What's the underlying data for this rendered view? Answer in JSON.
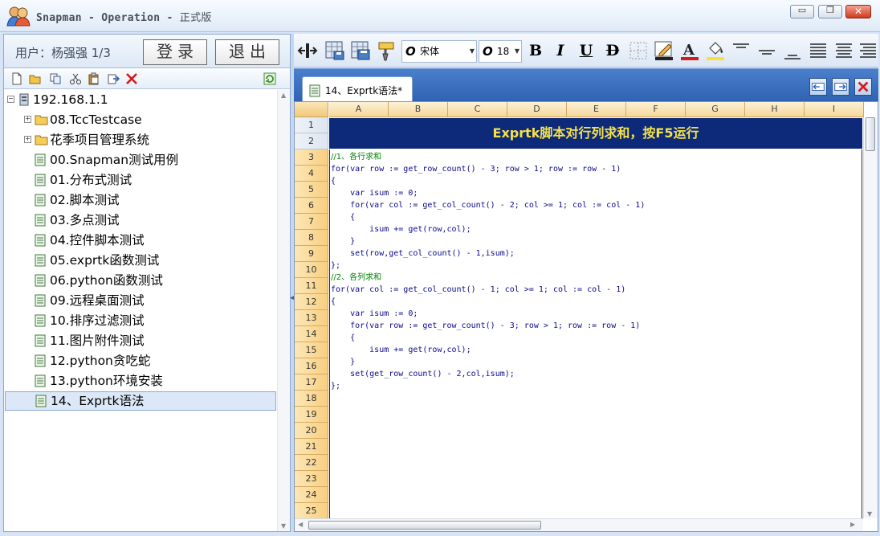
{
  "window": {
    "title": "Snapman - Operation - ",
    "title_edition": "正式版",
    "minimize_glyph": "▭",
    "restore_glyph": "❐",
    "close_glyph": "✕"
  },
  "user_bar": {
    "user_label": "用户：杨强强 1/3",
    "login_label": "登录",
    "logout_label": "退出"
  },
  "tree": {
    "root": "192.168.1.1",
    "folders": [
      "08.TccTestcase",
      "花季项目管理系统"
    ],
    "items": [
      "00.Snapman测试用例",
      "01.分布式测试",
      "02.脚本测试",
      "03.多点测试",
      "04.控件脚本测试",
      "05.exprtk函数测试",
      "06.python函数测试",
      "09.远程桌面测试",
      "10.排序过滤测试",
      "11.图片附件测试",
      "12.python贪吃蛇",
      "13.python环境安装",
      "14、Exprtk语法"
    ],
    "selected_index": 12
  },
  "format_toolbar": {
    "font_name": "宋体",
    "font_size": "18",
    "bold": "B",
    "italic": "I",
    "underline": "U",
    "strike": "D"
  },
  "document": {
    "tab_title": "14、Exprtk语法*",
    "banner": "Exprtk脚本对行列求和，按F5运行",
    "columns": [
      "A",
      "B",
      "C",
      "D",
      "E",
      "F",
      "G",
      "H",
      "I"
    ],
    "rows": [
      "1",
      "2",
      "3",
      "4",
      "5",
      "6",
      "7",
      "8",
      "9",
      "10",
      "11",
      "12",
      "13",
      "14",
      "15",
      "16",
      "17",
      "18",
      "19",
      "20",
      "21",
      "22",
      "23",
      "24",
      "25"
    ],
    "code": [
      "//1、各行求和",
      "for(var row := get_row_count() - 3; row > 1; row := row - 1)",
      "{",
      "    var isum := 0;",
      "    for(var col := get_col_count() - 2; col >= 1; col := col - 1)",
      "    {",
      "        isum += get(row,col);",
      "    }",
      "    set(row,get_col_count() - 1,isum);",
      "};",
      "//2、各列求和",
      "for(var col := get_col_count() - 1; col >= 1; col := col - 1)",
      "{",
      "    var isum := 0;",
      "    for(var row := get_row_count() - 3; row > 1; row := row - 1)",
      "    {",
      "        isum += get(row,col);",
      "    }",
      "    set(get_row_count() - 2,col,isum);",
      "};"
    ]
  },
  "colors": {
    "banner_bg": "#0d2a7a",
    "banner_text": "#f5e24a",
    "tab_strip": "#3a6fbf",
    "comment": "#008000"
  },
  "icons": [
    "app-logo-icon",
    "new-file-icon",
    "open-folder-icon",
    "copy-icon",
    "cut-icon",
    "paste-icon",
    "export-icon",
    "delete-icon",
    "refresh-icon",
    "split-columns-icon",
    "save-icon",
    "save-all-icon",
    "format-brush-icon",
    "border-grid-icon",
    "pencil-icon",
    "font-color-icon",
    "fill-color-icon",
    "align-top-icon",
    "align-middle-icon",
    "align-bottom-icon",
    "align-left-icon",
    "align-center-icon",
    "align-right-icon",
    "tab-prev-icon",
    "tab-next-icon",
    "tab-close-icon",
    "file-doc-icon",
    "folder-icon",
    "server-icon"
  ]
}
